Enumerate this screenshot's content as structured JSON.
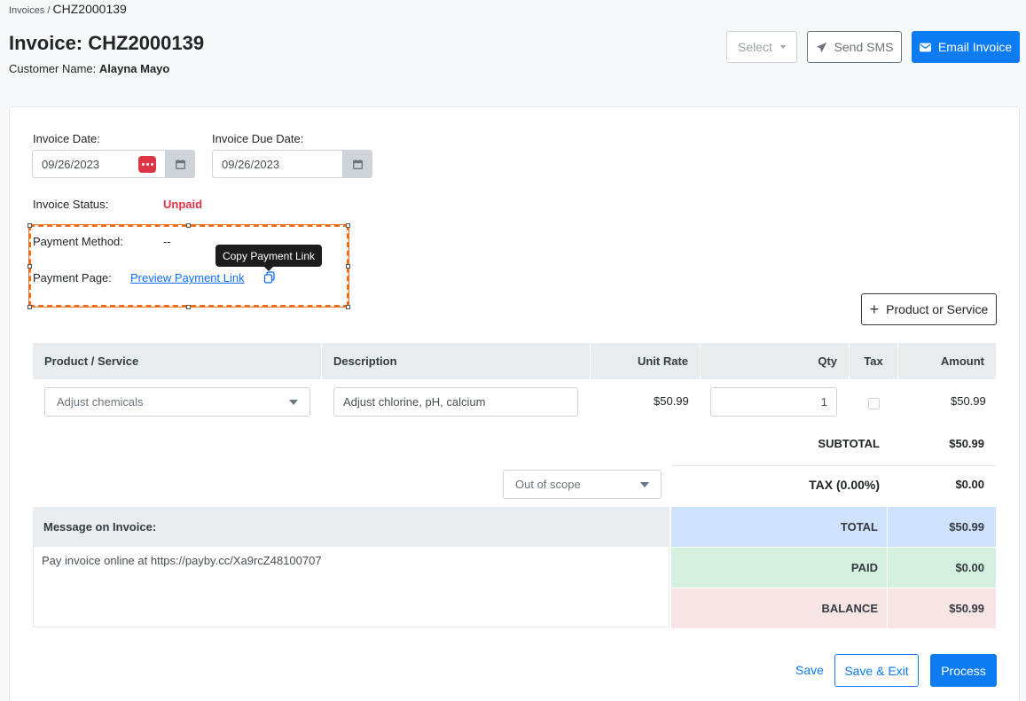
{
  "breadcrumb": {
    "parent": "Invoices",
    "separator": " / ",
    "current": "CHZ2000139"
  },
  "header": {
    "title": "Invoice: CHZ2000139",
    "customer_label": "Customer Name:",
    "customer_name": "Alayna Mayo",
    "select_label": "Select",
    "sms_label": "Send SMS",
    "email_label": "Email Invoice"
  },
  "form": {
    "invoice_date_label": "Invoice Date:",
    "invoice_date": "09/26/2023",
    "due_date_label": "Invoice Due Date:",
    "due_date": "09/26/2023",
    "status_label": "Invoice Status:",
    "status_value": "Unpaid",
    "payment_method_label": "Payment Method:",
    "payment_method_value": "--",
    "payment_page_label": "Payment Page:",
    "preview_link": "Preview Payment Link",
    "tooltip": "Copy Payment Link",
    "add_product_label": "Product or Service"
  },
  "table": {
    "headers": [
      "Product / Service",
      "Description",
      "Unit Rate",
      "Qty",
      "Tax",
      "Amount"
    ],
    "rows": [
      {
        "product": "Adjust chemicals",
        "description": "Adjust chlorine, pH, calcium",
        "unit_rate": "$50.99",
        "qty": "1",
        "amount": "$50.99"
      }
    ]
  },
  "totals": {
    "subtotal_label": "SUBTOTAL",
    "subtotal": "$50.99",
    "tax_select": "Out of scope",
    "tax_label": "TAX (0.00%)",
    "tax": "$0.00",
    "total_label": "TOTAL",
    "total": "$50.99",
    "paid_label": "PAID",
    "paid": "$0.00",
    "balance_label": "BALANCE",
    "balance": "$50.99"
  },
  "message": {
    "label": "Message on Invoice:",
    "text": "Pay invoice online at https://payby.cc/Xa9rcZ48100707"
  },
  "footer": {
    "save": "Save",
    "save_exit": "Save & Exit",
    "process": "Process"
  },
  "colors": {
    "primary": "#0d7bf2",
    "danger": "#dc3545",
    "highlight": "#ef6c1a",
    "total_bg": "#cfe2fc",
    "paid_bg": "#d4f1e0",
    "balance_bg": "#f7e4e4"
  }
}
